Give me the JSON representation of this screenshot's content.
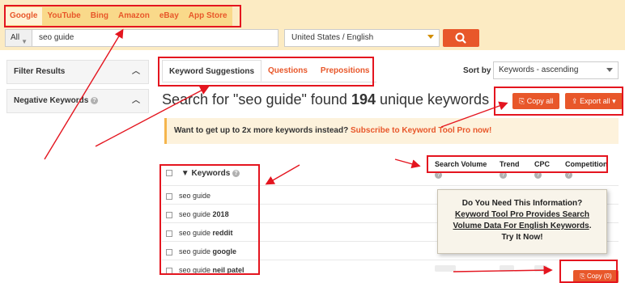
{
  "search_sources": [
    "Google",
    "YouTube",
    "Bing",
    "Amazon",
    "eBay",
    "App Store"
  ],
  "search": {
    "scope_label": "All",
    "query": "seo guide",
    "country_language": "United States / English"
  },
  "sidebar": {
    "filter_results": "Filter Results",
    "negative_keywords": "Negative Keywords"
  },
  "result_tabs": [
    "Keyword Suggestions",
    "Questions",
    "Prepositions"
  ],
  "sort": {
    "label": "Sort by",
    "value": "Keywords - ascending"
  },
  "headline": {
    "prefix": "Search for \"seo guide\" found ",
    "count": "194",
    "suffix": " unique keywords"
  },
  "actions": {
    "copy_all": "Copy all",
    "export_all": "Export all"
  },
  "promo": {
    "text": "Want to get up to 2x more keywords instead? ",
    "link": "Subscribe to Keyword Tool Pro now!"
  },
  "table": {
    "keyword_header": "Keywords",
    "columns": [
      "Search Volume",
      "Trend",
      "CPC",
      "Competition"
    ],
    "rows": [
      {
        "base": "seo guide",
        "extra": ""
      },
      {
        "base": "seo guide ",
        "extra": "2018"
      },
      {
        "base": "seo guide ",
        "extra": "reddit"
      },
      {
        "base": "seo guide ",
        "extra": "google"
      },
      {
        "base": "seo guide ",
        "extra": "neil patel"
      }
    ]
  },
  "popup": {
    "line1": "Do You Need This Information?",
    "line2a": "Keyword Tool Pro Provides Search",
    "line2b": "Volume Data For English Keywords",
    "line2c": ".",
    "line3": "Try It Now!"
  },
  "copy_button": "Copy (0)",
  "colors": {
    "accent": "#e8572a",
    "annotation": "#e4151f",
    "topbar_bg": "#fcebc3"
  },
  "icons": [
    "search-icon",
    "chevron-up-icon",
    "help-icon",
    "copy-icon",
    "export-icon",
    "caret-down-icon"
  ]
}
